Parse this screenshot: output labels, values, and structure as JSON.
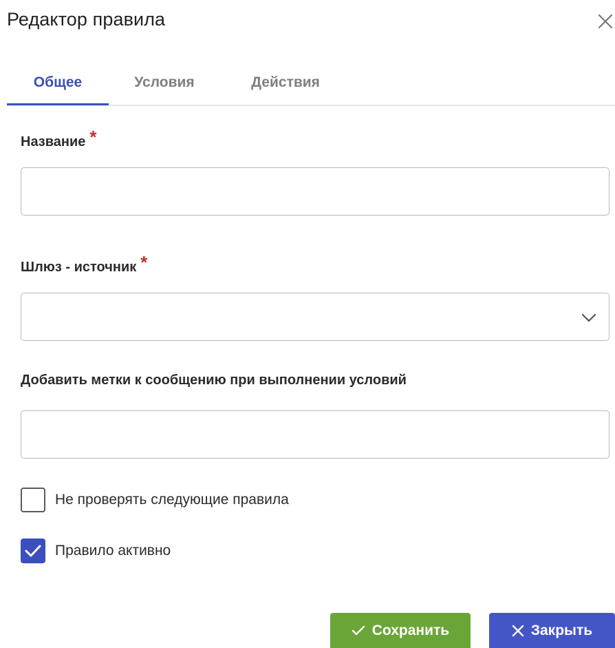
{
  "dialog": {
    "title": "Редактор правила"
  },
  "tabs": [
    {
      "label": "Общее",
      "active": true
    },
    {
      "label": "Условия",
      "active": false
    },
    {
      "label": "Действия",
      "active": false
    }
  ],
  "form": {
    "name": {
      "label": "Название",
      "required_mark": "*",
      "value": ""
    },
    "gateway": {
      "label": "Шлюз - источник",
      "required_mark": "*",
      "value": ""
    },
    "tags": {
      "label": "Добавить метки к сообщению при выполнении условий",
      "value": ""
    },
    "skip_next_rules": {
      "label": "Не проверять следующие правила",
      "checked": false
    },
    "rule_active": {
      "label": "Правило активно",
      "checked": true
    }
  },
  "footer": {
    "save_label": "Сохранить",
    "close_label": "Закрыть"
  },
  "colors": {
    "accent": "#3c4fbf",
    "save_button": "#6aa637",
    "close_button": "#4456c6",
    "required": "#c4322b"
  },
  "icons": {
    "close": "close-icon",
    "dropdown": "chevron-down-icon",
    "check": "check-icon"
  }
}
